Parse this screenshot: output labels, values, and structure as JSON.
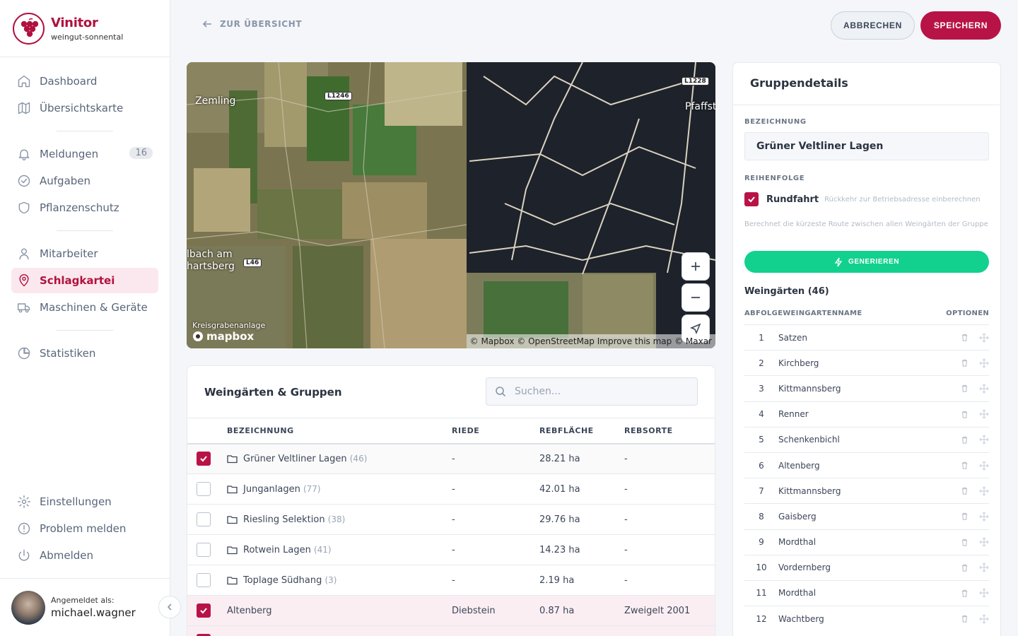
{
  "brand": {
    "name": "Vinitor",
    "subtitle": "weingut-sonnental"
  },
  "nav": {
    "main": [
      {
        "label": "Dashboard",
        "icon": "home-icon"
      },
      {
        "label": "Übersichtskarte",
        "icon": "map-icon"
      }
    ],
    "group2": [
      {
        "label": "Meldungen",
        "icon": "bell-icon",
        "badge": "16"
      },
      {
        "label": "Aufgaben",
        "icon": "check-circle-icon"
      },
      {
        "label": "Pflanzenschutz",
        "icon": "shield-icon"
      }
    ],
    "group3": [
      {
        "label": "Mitarbeiter",
        "icon": "user-icon"
      },
      {
        "label": "Schlagkartei",
        "icon": "map-pin-icon",
        "active": true
      },
      {
        "label": "Maschinen & Geräte",
        "icon": "truck-icon"
      }
    ],
    "group4": [
      {
        "label": "Statistiken",
        "icon": "pie-chart-icon"
      }
    ],
    "bottom": [
      {
        "label": "Einstellungen",
        "icon": "gear-icon"
      },
      {
        "label": "Problem melden",
        "icon": "alert-circle-icon"
      },
      {
        "label": "Abmelden",
        "icon": "power-icon"
      }
    ]
  },
  "user": {
    "label": "Angemeldet als:",
    "name": "michael.wagner"
  },
  "topbar": {
    "back_label": "ZUR ÜBERSICHT",
    "cancel_label": "ABBRECHEN",
    "save_label": "SPEICHERN"
  },
  "map": {
    "places": [
      "Zemling",
      "Pfaffst",
      "lbach am",
      "hartsberg",
      "Kreisgrabenanlage"
    ],
    "roads": [
      "L1246",
      "L1228",
      "L46"
    ],
    "attribution": "© Mapbox © OpenStreetMap Improve this map © Maxar",
    "logo": "mapbox"
  },
  "table": {
    "title": "Weingärten & Gruppen",
    "search_placeholder": "Suchen...",
    "columns": [
      "BEZEICHNUNG",
      "RIEDE",
      "REBFLÄCHE",
      "REBSORTE"
    ],
    "rows": [
      {
        "checked": true,
        "group": true,
        "name": "Grüner Veltliner Lagen",
        "count": "(46)",
        "riede": "-",
        "flaeche": "28.21 ha",
        "sorte": "-"
      },
      {
        "checked": false,
        "group": true,
        "name": "Junganlagen",
        "count": "(77)",
        "riede": "-",
        "flaeche": "42.01 ha",
        "sorte": "-"
      },
      {
        "checked": false,
        "group": true,
        "name": "Riesling Selektion",
        "count": "(38)",
        "riede": "-",
        "flaeche": "29.76 ha",
        "sorte": "-"
      },
      {
        "checked": false,
        "group": true,
        "name": "Rotwein Lagen",
        "count": "(41)",
        "riede": "-",
        "flaeche": "14.23 ha",
        "sorte": "-"
      },
      {
        "checked": false,
        "group": true,
        "name": "Toplage Südhang",
        "count": "(3)",
        "riede": "-",
        "flaeche": "2.19 ha",
        "sorte": "-"
      },
      {
        "checked": true,
        "group": false,
        "name": "Altenberg",
        "count": "",
        "riede": "Diebstein",
        "flaeche": "0.87 ha",
        "sorte": "Zweigelt 2001"
      }
    ]
  },
  "panel": {
    "title": "Gruppendetails",
    "name_label": "BEZEICHNUNG",
    "name_value": "Grüner Veltliner Lagen",
    "order_label": "REIHENFOLGE",
    "roundtrip_label": "Rundfahrt",
    "roundtrip_hint": "Rückkehr zur Betriebsadresse einberechnen",
    "route_hint": "Berechnet die kürzeste Route zwischen allen Weingärten der Gruppe",
    "generate_label": "GENERIEREN",
    "vineyards_title": "Weingärten (46)",
    "col_order": "ABFOLGE",
    "col_name": "WEINGARTENNAME",
    "col_options": "OPTIONEN",
    "vineyards": [
      {
        "n": "1",
        "name": "Satzen"
      },
      {
        "n": "2",
        "name": "Kirchberg"
      },
      {
        "n": "3",
        "name": "Kittmannsberg"
      },
      {
        "n": "4",
        "name": "Renner"
      },
      {
        "n": "5",
        "name": "Schenkenbichl"
      },
      {
        "n": "6",
        "name": "Altenberg"
      },
      {
        "n": "7",
        "name": "Kittmannsberg"
      },
      {
        "n": "8",
        "name": "Gaisberg"
      },
      {
        "n": "9",
        "name": "Mordthal"
      },
      {
        "n": "10",
        "name": "Vordernberg"
      },
      {
        "n": "11",
        "name": "Mordthal"
      },
      {
        "n": "12",
        "name": "Wachtberg"
      }
    ]
  },
  "colors": {
    "accent": "#b81347",
    "generate": "#12d18e",
    "active_bg": "#fbe8ee"
  }
}
